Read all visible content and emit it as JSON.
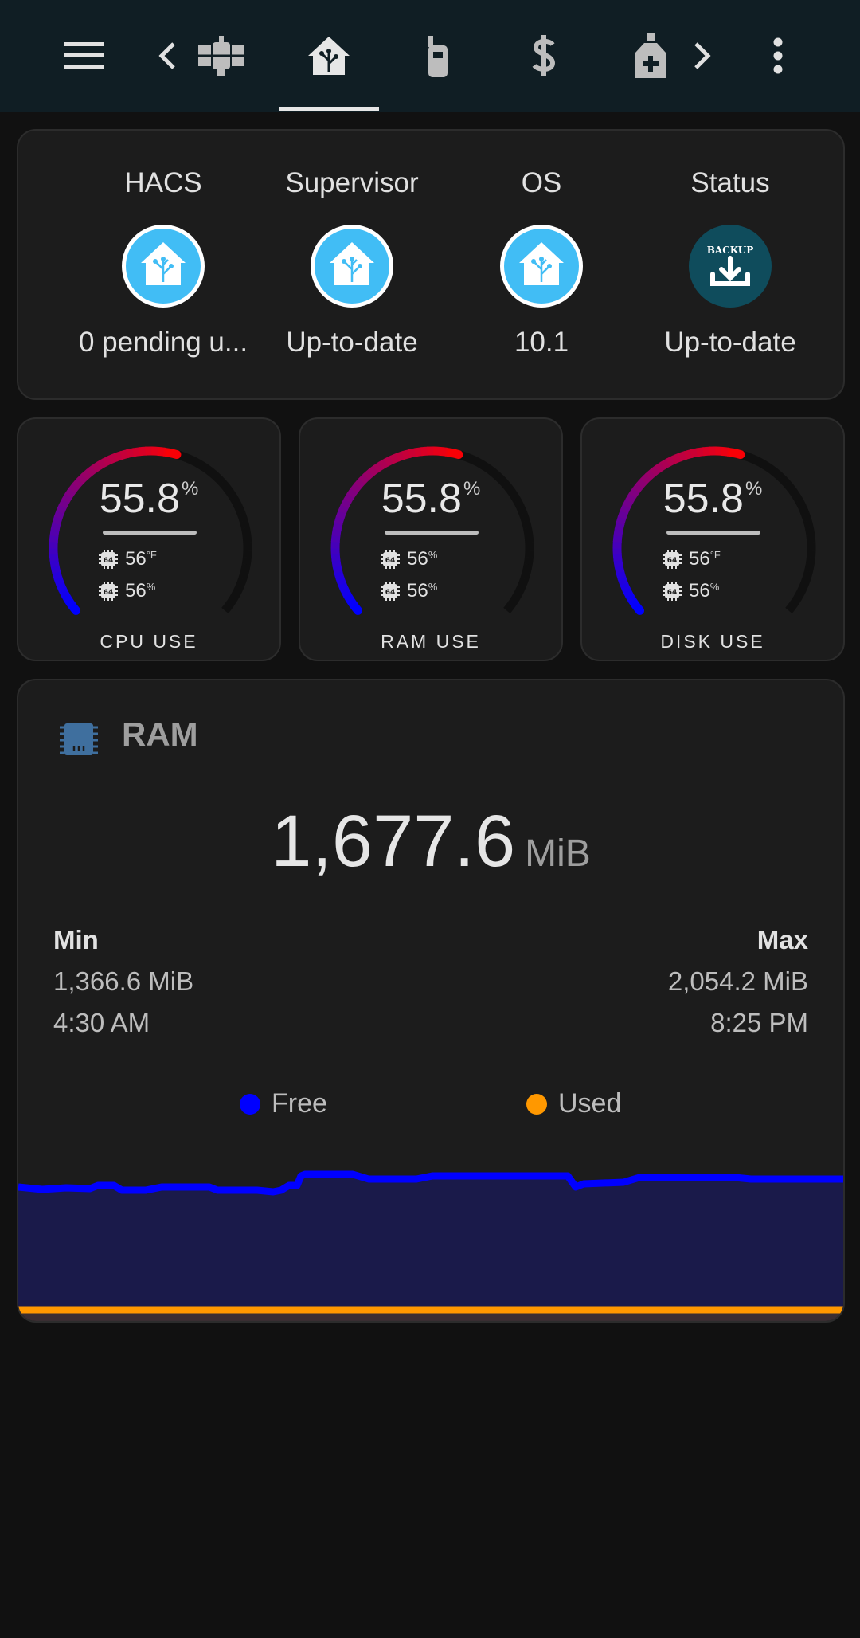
{
  "topbar": {
    "icons": [
      "menu-icon",
      "chevron-left-icon",
      "satellite-icon",
      "home-assistant-icon",
      "cellphone-icon",
      "currency-usd-icon",
      "medical-bottle-icon",
      "chevron-right-icon",
      "dots-vertical-icon"
    ],
    "active_tab": "home-assistant-icon"
  },
  "status": {
    "items": [
      {
        "title": "HACS",
        "value": "0 pending u...",
        "icon": "home-assistant-logo-icon"
      },
      {
        "title": "Supervisor",
        "value": "Up-to-date",
        "icon": "home-assistant-logo-icon"
      },
      {
        "title": "OS",
        "value": "10.1",
        "icon": "home-assistant-logo-icon"
      },
      {
        "title": "Status",
        "value": "Up-to-date",
        "icon": "backup-icon",
        "badge_text": "BACKUP"
      }
    ]
  },
  "gauges": [
    {
      "label": "CPU USE",
      "value": "55.8",
      "unit": "%",
      "fraction": 0.558,
      "sub1": "56",
      "sub1_unit": "°F",
      "sub2": "56",
      "sub2_unit": "%"
    },
    {
      "label": "RAM USE",
      "value": "55.8",
      "unit": "%",
      "fraction": 0.558,
      "sub1": "56",
      "sub1_unit": "%",
      "sub2": "56",
      "sub2_unit": "%"
    },
    {
      "label": "DISK USE",
      "value": "55.8",
      "unit": "%",
      "fraction": 0.558,
      "sub1": "56",
      "sub1_unit": "°F",
      "sub2": "56",
      "sub2_unit": "%"
    }
  ],
  "ram": {
    "title": "RAM",
    "value": "1,677.6",
    "unit": "MiB",
    "min": {
      "label": "Min",
      "value": "1,366.6 MiB",
      "time": "4:30 AM"
    },
    "max": {
      "label": "Max",
      "value": "2,054.2 MiB",
      "time": "8:25 PM"
    },
    "legend": [
      {
        "name": "Free",
        "color": "#0000ff"
      },
      {
        "name": "Used",
        "color": "#ff9800"
      }
    ]
  },
  "colors": {
    "gauge_start": "#0000ff",
    "gauge_end": "#ff0000",
    "free": "#0000ff",
    "used": "#ff9800",
    "ha_blue": "#41bdf5",
    "backup_teal": "#0f4c5c"
  }
}
